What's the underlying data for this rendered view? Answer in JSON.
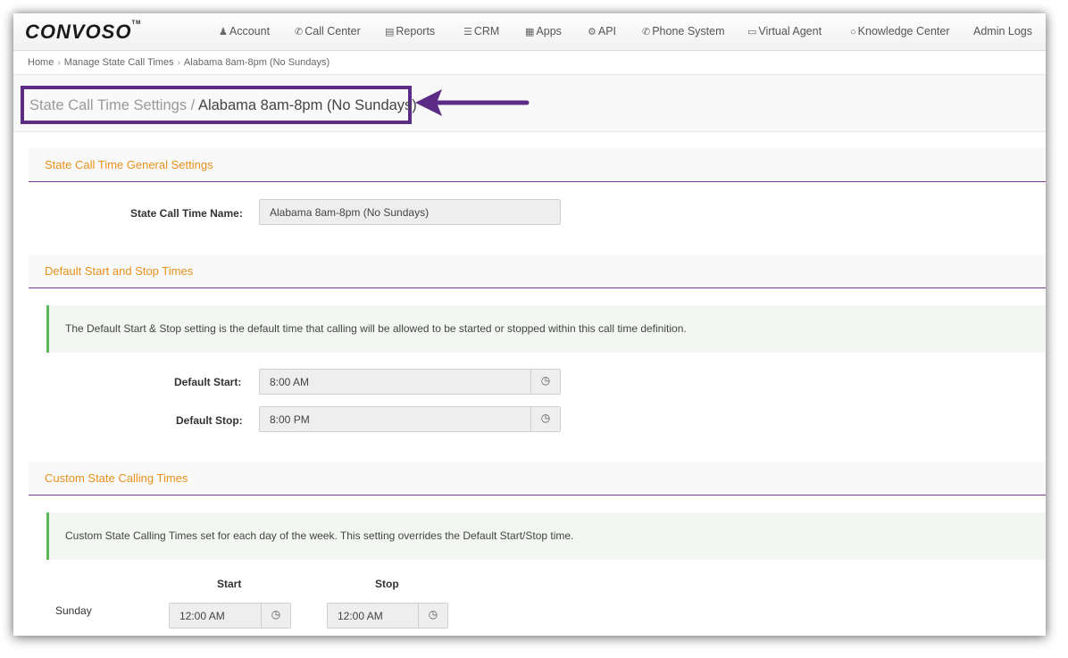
{
  "brand": {
    "logo": "CONVOSO",
    "tm": "TM"
  },
  "nav": [
    {
      "label": "Account",
      "icon": "user-icon"
    },
    {
      "label": "Call Center",
      "icon": "phone-icon"
    },
    {
      "label": "Reports",
      "icon": "bar-chart-icon"
    },
    {
      "label": "CRM",
      "icon": "list-icon"
    },
    {
      "label": "Apps",
      "icon": "grid-icon"
    },
    {
      "label": "API",
      "icon": "gear-icon"
    },
    {
      "label": "Phone System",
      "icon": "phone-icon"
    },
    {
      "label": "Virtual Agent",
      "icon": "monitor-icon"
    },
    {
      "label": "Knowledge Center",
      "icon": "lightbulb-icon"
    },
    {
      "label": "Admin Logs",
      "icon": ""
    }
  ],
  "breadcrumb": [
    "Home",
    "Manage State Call Times",
    "Alabama 8am-8pm (No Sundays)"
  ],
  "header": {
    "title_prefix": "State Call Time Settings /",
    "title_name": "Alabama 8am-8pm (No Sundays)",
    "highlight_color": "#5b2b86"
  },
  "general": {
    "heading": "State Call Time General Settings",
    "name_label": "State Call Time Name:",
    "name_value": "Alabama 8am-8pm (No Sundays)"
  },
  "defaults": {
    "heading": "Default Start and Stop Times",
    "info": "The Default Start & Stop setting is the default time that calling will be allowed to be started or stopped within this call time definition.",
    "start_label": "Default Start:",
    "start_value": "8:00 AM",
    "stop_label": "Default Stop:",
    "stop_value": "8:00 PM"
  },
  "custom": {
    "heading": "Custom State Calling Times",
    "info": "Custom State Calling Times set for each day of the week. This setting overrides the Default Start/Stop time.",
    "start_header": "Start",
    "stop_header": "Stop",
    "rows": [
      {
        "day": "Sunday",
        "start": "12:00 AM",
        "stop": "12:00 AM"
      }
    ]
  }
}
